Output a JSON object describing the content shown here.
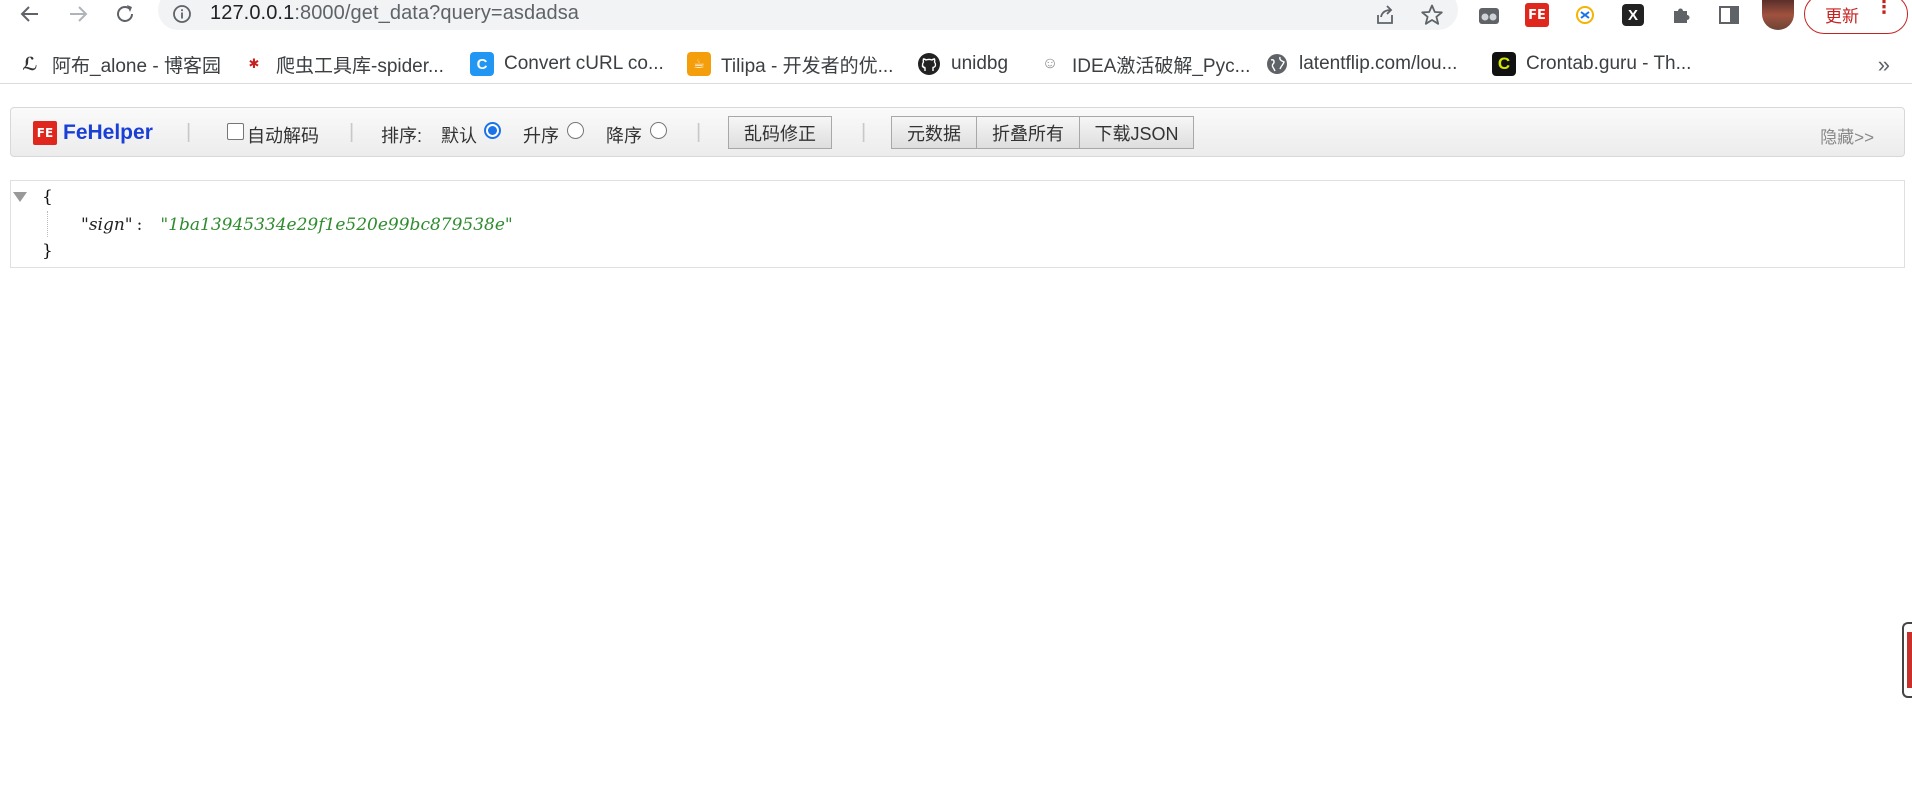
{
  "browser": {
    "url_host": "127.0.0.1",
    "url_rest": ":8000/get_data?query=asdadsa",
    "update_label": "更新",
    "update_dots": "⋮",
    "icons": [
      "back-icon",
      "forward-icon",
      "reload-icon",
      "info-icon",
      "share-icon",
      "star-icon",
      "glasses-icon",
      "fehelper-icon",
      "extension-icon",
      "x-icon",
      "puzzle-icon",
      "sidepanel-icon"
    ]
  },
  "bookmarks": [
    {
      "label": "阿布_alone - 博客园",
      "icon": "blog-icon"
    },
    {
      "label": "爬虫工具库-spider...",
      "icon": "spider-icon"
    },
    {
      "label": "Convert cURL co...",
      "icon": "curl-icon"
    },
    {
      "label": "Tilipa - 开发者的优...",
      "icon": "tilipa-icon"
    },
    {
      "label": "unidbg",
      "icon": "github-icon"
    },
    {
      "label": "IDEA激活破解_Pyc...",
      "icon": "idea-icon"
    },
    {
      "label": "latentflip.com/lou...",
      "icon": "globe-icon"
    },
    {
      "label": "Crontab.guru - Th...",
      "icon": "crontab-icon"
    }
  ],
  "bookmarks_more": "»",
  "fehelper": {
    "logo_icon": "FE",
    "logo_text": "FeHelper",
    "separator": "|",
    "auto_decode": "自动解码",
    "sort_label": "排序:",
    "sort_default": "默认",
    "sort_asc": "升序",
    "sort_desc": "降序",
    "fix_garbled": "乱码修正",
    "metadata": "元数据",
    "collapse_all": "折叠所有",
    "download_json": "下载JSON",
    "hide": "隐藏>>",
    "sort_selected": "默认",
    "auto_decode_checked": false
  },
  "json": {
    "open_brace": "{",
    "close_brace": "}",
    "key": "\"sign\"",
    "colon": ":",
    "value": "\"1ba13945334e29f1e520e99bc879538e\""
  },
  "colors": {
    "fe_red": "#e0271d",
    "fe_blue": "#1a3fd6",
    "json_string": "#2e8b2e",
    "update_red": "#c5221f"
  }
}
